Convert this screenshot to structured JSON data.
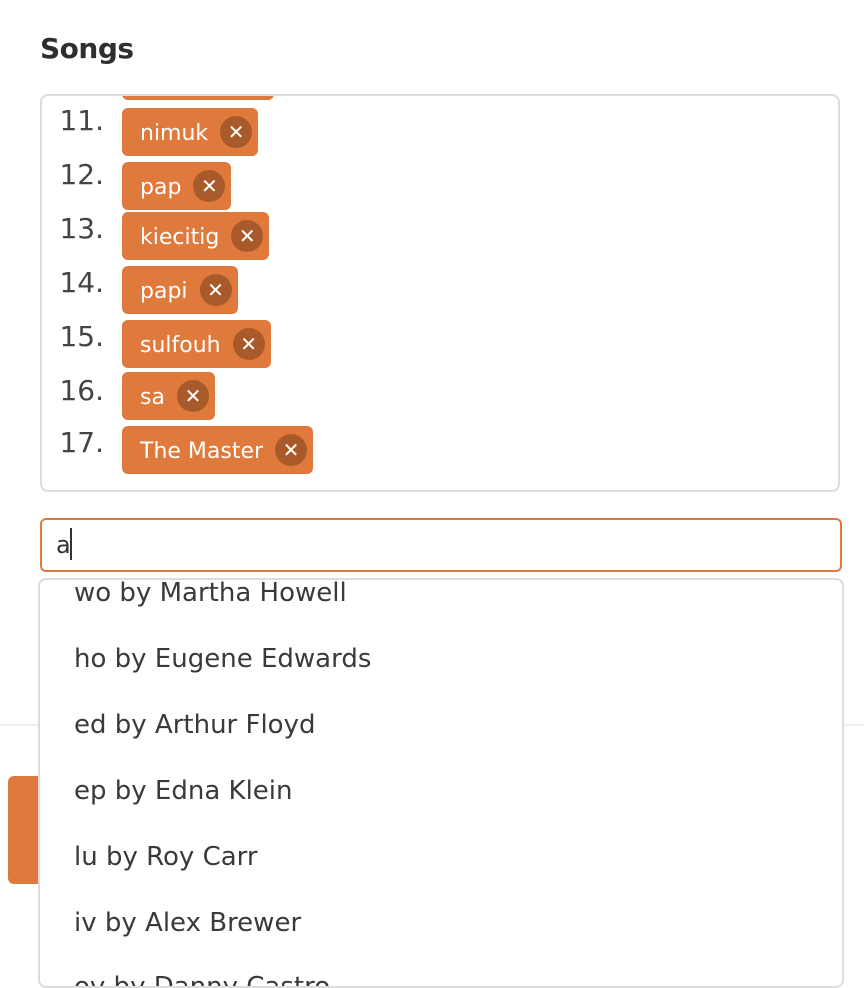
{
  "section": {
    "title": "Songs"
  },
  "songs": [
    {
      "number": "11.",
      "title": "nimuk"
    },
    {
      "number": "12.",
      "title": "pap"
    },
    {
      "number": "13.",
      "title": "kiecitig"
    },
    {
      "number": "14.",
      "title": "papi"
    },
    {
      "number": "15.",
      "title": "sulfouh"
    },
    {
      "number": "16.",
      "title": "sa"
    },
    {
      "number": "17.",
      "title": "The Master"
    }
  ],
  "remove_icon": {
    "name": "close-circle-icon",
    "glyph": "✕"
  },
  "search": {
    "value": "a"
  },
  "suggestions": [
    "wo by Martha Howell",
    "ho by Eugene Edwards",
    "ed by Arthur Floyd",
    "ep by Edna Klein",
    "lu by Roy Carr",
    "iv by Alex Brewer",
    "ov by Danny Castro"
  ],
  "colors": {
    "accent": "#e07a3c",
    "accent_dark": "#a85a2b",
    "border": "#dcdcdc"
  }
}
